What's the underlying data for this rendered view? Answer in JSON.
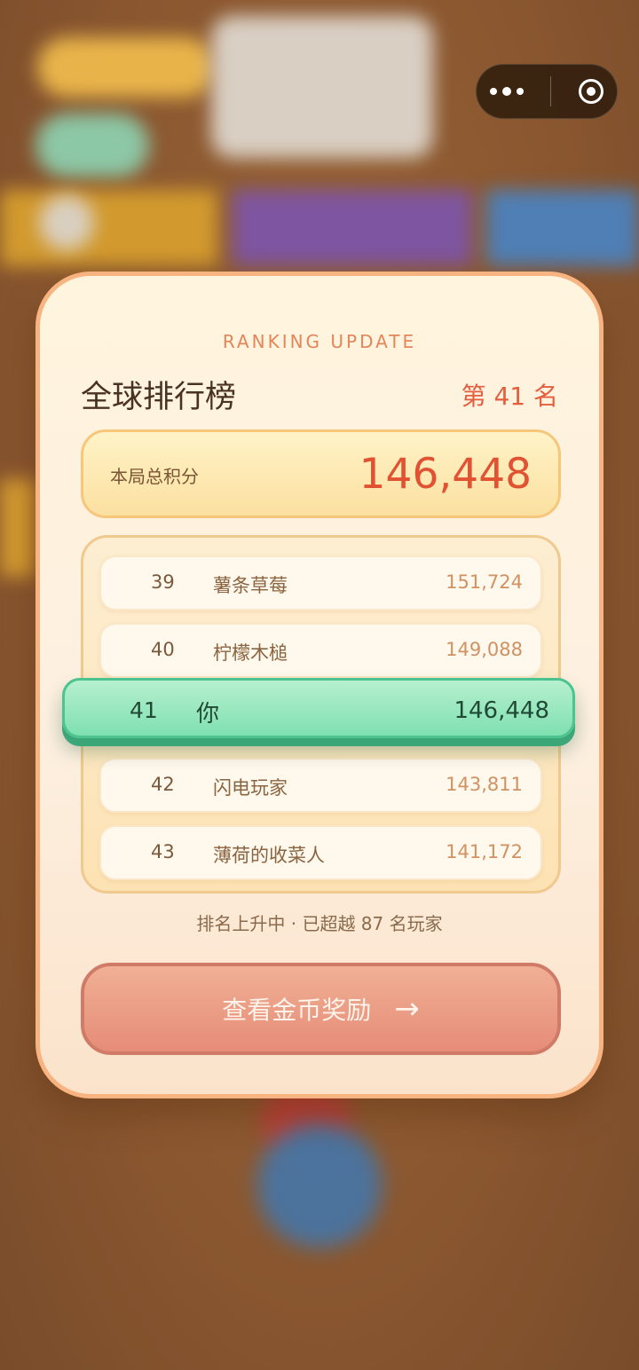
{
  "panel": {
    "kicker": "RANKING UPDATE",
    "title": "全球排行榜",
    "rank_text": "第 41 名",
    "score_label": "本局总积分",
    "score_value": "146,448"
  },
  "leaderboard": [
    {
      "rank": "39",
      "name": "薯条草莓",
      "score": "151,724"
    },
    {
      "rank": "40",
      "name": "柠檬木槌",
      "score": "149,088"
    },
    {
      "rank": "41",
      "name": "你",
      "score": "146,448"
    },
    {
      "rank": "42",
      "name": "闪电玩家",
      "score": "143,811"
    },
    {
      "rank": "43",
      "name": "薄荷的收菜人",
      "score": "141,172"
    }
  ],
  "status_note": "排名上升中 · 已超越 87 名玩家",
  "cta": {
    "label": "查看金币奖励",
    "arrow": "→"
  },
  "colors": {
    "accent_red": "#e15233",
    "highlight_green": "#7fe0b0",
    "panel_border": "#f7b480"
  },
  "icons": {
    "menu": "more-dots-icon",
    "close": "target-circle-icon"
  }
}
